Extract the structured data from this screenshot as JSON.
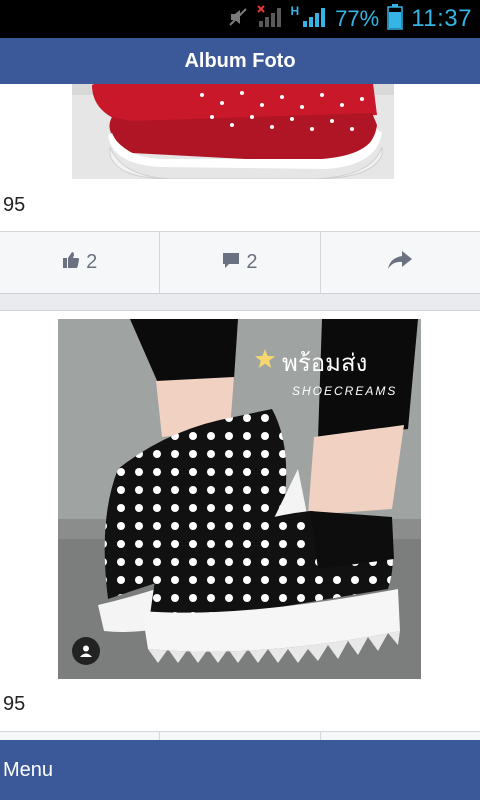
{
  "status_bar": {
    "battery_percent": "77%",
    "time": "11:37",
    "network_type": "H",
    "accent_color": "#34b5e5"
  },
  "header": {
    "title": "Album Foto",
    "color": "#3b5998"
  },
  "posts": [
    {
      "caption": "95",
      "likes": "2",
      "comments": "2"
    },
    {
      "caption": "95",
      "watermark_line1": "พร้อมส่ง",
      "watermark_line2": "SHOECREAMS"
    }
  ],
  "footer": {
    "menu_label": "Menu"
  },
  "icons": {
    "mute": "mute-icon",
    "signal": "signal-icon",
    "battery": "battery-icon",
    "like": "thumbs-up-icon",
    "comment": "comment-icon",
    "share": "share-icon",
    "user": "user-icon",
    "star": "star-icon"
  }
}
